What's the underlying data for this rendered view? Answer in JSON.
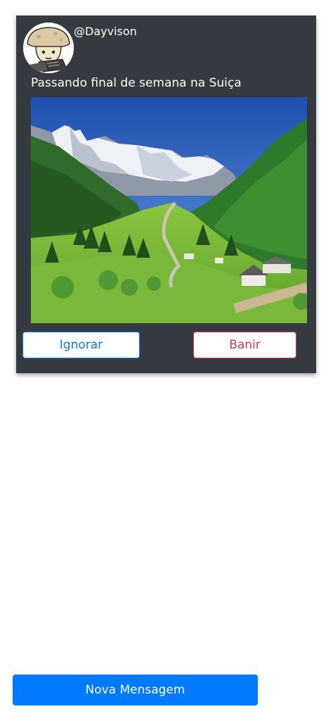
{
  "post": {
    "username": "@Dayvison",
    "caption": "Passando final de semana na Suiça",
    "avatar_icon": "mushroom-character-avatar",
    "photo": "alpine-valley-landscape"
  },
  "actions": {
    "ignore_label": "Ignorar",
    "ban_label": "Banir"
  },
  "footer": {
    "new_message_label": "Nova Mensagem"
  },
  "colors": {
    "card_background": "#343a40",
    "primary": "#007bff",
    "danger": "#dc3545"
  }
}
